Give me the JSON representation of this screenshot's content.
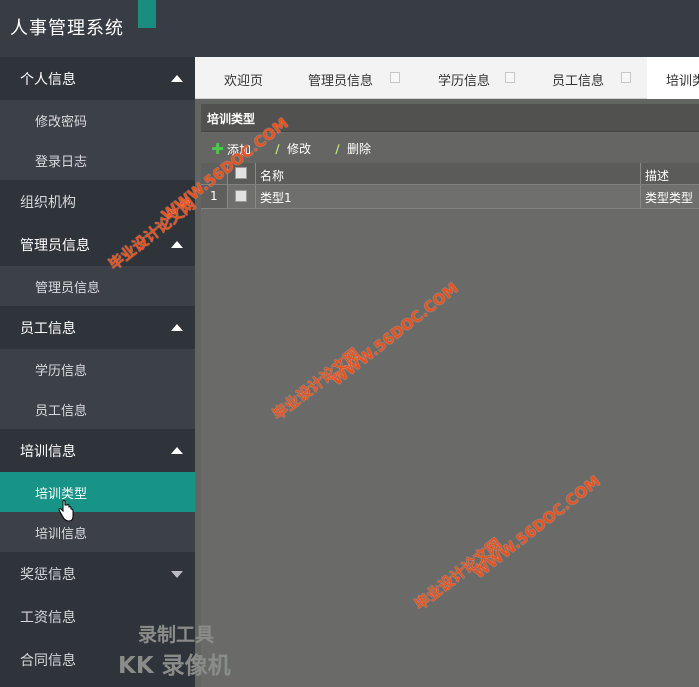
{
  "app": {
    "title": "人事管理系统",
    "accent_color": "#179487"
  },
  "sidebar": {
    "groups": [
      {
        "label": "个人信息",
        "arrow": "up",
        "items": [
          "修改密码",
          "登录日志"
        ]
      },
      {
        "label": "组织机构",
        "arrow": "none",
        "items": []
      },
      {
        "label": "管理员信息",
        "arrow": "up",
        "items": [
          "管理员信息"
        ]
      },
      {
        "label": "员工信息",
        "arrow": "up",
        "items": [
          "学历信息",
          "员工信息"
        ]
      },
      {
        "label": "培训信息",
        "arrow": "up",
        "items": [
          "培训类型",
          "培训信息"
        ],
        "active_item": "培训类型"
      },
      {
        "label": "奖惩信息",
        "arrow": "down",
        "items": []
      },
      {
        "label": "工资信息",
        "arrow": "none",
        "items": []
      },
      {
        "label": "合同信息",
        "arrow": "none",
        "items": []
      }
    ]
  },
  "tabs": [
    {
      "label": "欢迎页",
      "closable": false
    },
    {
      "label": "管理员信息",
      "closable": true
    },
    {
      "label": "学历信息",
      "closable": true
    },
    {
      "label": "员工信息",
      "closable": true
    },
    {
      "label": "培训类",
      "closable": false,
      "active": true
    }
  ],
  "panel": {
    "title": "培训类型",
    "toolbar": {
      "add_label": "添加",
      "edit_label": "修改",
      "delete_label": "删除"
    },
    "columns": {
      "name": "名称",
      "desc": "描述"
    },
    "rows": [
      {
        "num": "1",
        "name": "类型1",
        "desc": "类型类型"
      }
    ]
  },
  "watermarks": {
    "url": "WWW.56DOC.COM",
    "text": "毕业设计论文网",
    "recorder_line1": "录制工具",
    "recorder_line2": "KK 录像机"
  }
}
